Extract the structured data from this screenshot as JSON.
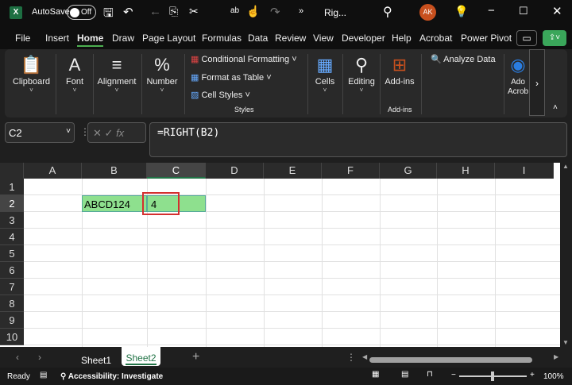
{
  "titlebar": {
    "autosave": "AutoSave",
    "toggle": "Off",
    "doc": "Rig...",
    "avatar": "AK"
  },
  "menu": [
    "File",
    "Insert",
    "Home",
    "Draw",
    "Page Layout",
    "Formulas",
    "Data",
    "Review",
    "View",
    "Developer",
    "Help",
    "Acrobat",
    "Power Pivot"
  ],
  "ribbon": {
    "clipboard": "Clipboard",
    "font": "Font",
    "alignment": "Alignment",
    "number": "Number",
    "cond": "Conditional Formatting",
    "table": "Format as Table",
    "styles_btn": "Cell Styles",
    "styles": "Styles",
    "cells": "Cells",
    "editing": "Editing",
    "addins": "Add-ins",
    "addins_group": "Add-ins",
    "analyze": "Analyze Data",
    "acrobat": "Ado Acrob"
  },
  "formula": {
    "namebox": "C2",
    "fx": "fx",
    "value": "=RIGHT(B2)"
  },
  "columns": [
    "A",
    "B",
    "C",
    "D",
    "E",
    "F",
    "G",
    "H",
    "I"
  ],
  "rows": [
    "1",
    "2",
    "3",
    "4",
    "5",
    "6",
    "7",
    "8",
    "9",
    "10"
  ],
  "cells": {
    "B2": "ABCD124",
    "C2": "4"
  },
  "colors": {
    "highlight": "#8ee08e",
    "selection": "#d32f2f",
    "accent": "#217346"
  },
  "sheets": [
    "Sheet1",
    "Sheet2"
  ],
  "status": {
    "ready": "Ready",
    "accessibility": "Accessibility: Investigate",
    "zoom": "100%"
  }
}
